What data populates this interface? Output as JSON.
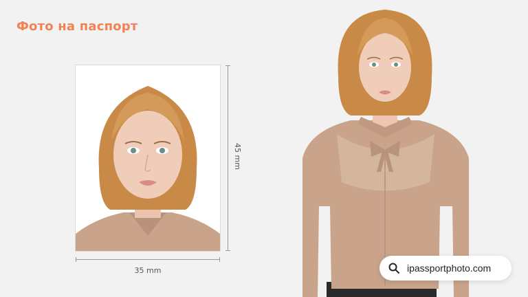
{
  "header": {
    "title": "Фото на паспорт"
  },
  "photo_spec": {
    "width_label": "35 mm",
    "height_label": "45 mm"
  },
  "search": {
    "text": "ipassportphoto.com",
    "icon": "search-icon"
  },
  "colors": {
    "accent": "#f08254",
    "background": "#f2f2f2",
    "hair": "#c98a48",
    "blouse": "#c9a48a"
  }
}
